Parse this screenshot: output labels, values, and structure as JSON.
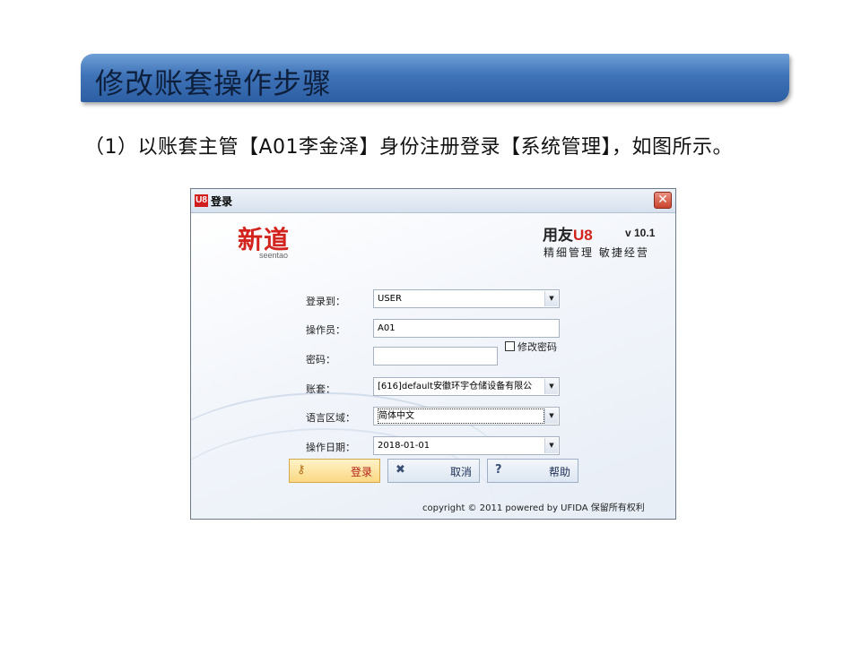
{
  "slide": {
    "title": "修改账套操作步骤",
    "paragraph": "（1）以账套主管【A01李金泽】身份注册登录【系统管理】，如图所示。"
  },
  "dialog": {
    "title": "登录",
    "logo_mark": "U8",
    "close_glyph": "✕",
    "brand": {
      "name": "新道",
      "sub": "seentao"
    },
    "product": {
      "name": "用友",
      "u8": "U8",
      "version": "v 10.1",
      "slogan": "精细管理 敏捷经营"
    },
    "form": {
      "login_to_label": "登录到：",
      "login_to_value": "USER",
      "operator_label": "操作员：",
      "operator_value": "A01",
      "password_label": "密码：",
      "password_value": "",
      "change_password_label": "修改密码",
      "change_password_checked": false,
      "account_label": "账套：",
      "account_value": "[616]default安徽环宇仓储设备有限公",
      "language_label": "语言区域：",
      "language_value": "简体中文",
      "date_label": "操作日期：",
      "date_value": "2018-01-01"
    },
    "buttons": {
      "login": {
        "label": "登录",
        "icon": "key-icon"
      },
      "cancel": {
        "label": "取消",
        "icon": "x-icon"
      },
      "help": {
        "label": "帮助",
        "icon": "question-icon"
      }
    },
    "copyright": "copyright © 2011 powered by UFIDA 保留所有权利",
    "colors": {
      "brand_red": "#d2231c",
      "title_bar_blue": "#3f73b8"
    }
  }
}
